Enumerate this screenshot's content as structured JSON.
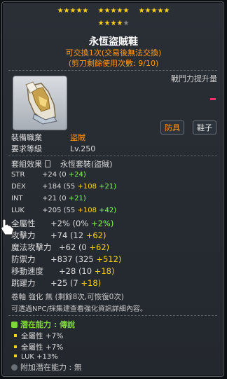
{
  "stars": {
    "filled_groups": [
      "★★★★★",
      "★★★★★",
      "★★★★★"
    ],
    "row2_filled": "★★★★",
    "row2_dim": "★"
  },
  "title": "永恆盜賊鞋",
  "tradeable_line": "可交換1次(交易後無法交換)",
  "scissors_line": "(剪刀剩餘使用次數: 9/10)",
  "combat_power_label": "戰鬥力提升量",
  "tags": {
    "job": "防具",
    "kind": "鞋子"
  },
  "equip_job_label": "裝備職業",
  "equip_job_value": "盜賊",
  "req_level_label": "要求等級",
  "req_level_value": "Lv.250",
  "set_label": "套組效果",
  "set_value": "永恆套裝(盜賊)",
  "stats": [
    {
      "name": "STR",
      "v": "+24",
      "p1": "(0",
      "p2": "+24)",
      "p3": ""
    },
    {
      "name": "DEX",
      "v": "+184",
      "p1": "(55",
      "p2": "+108",
      "p3": "+21)"
    },
    {
      "name": "INT",
      "v": "+21",
      "p1": "(0",
      "p2": "+21)",
      "p3": ""
    },
    {
      "name": "LUK",
      "v": "+205",
      "p1": "(55",
      "p2": "+108",
      "p3": "+42)"
    }
  ],
  "big_stats": [
    {
      "name": "全屬性",
      "v": "+2%",
      "p1": "(0%",
      "p2": "+2%)",
      "p3": ""
    },
    {
      "name": "攻擊力",
      "v": "+74",
      "p1": "(12",
      "p2": "+62)",
      "p3": ""
    },
    {
      "name": "魔法攻擊力",
      "v": "+62",
      "p1": "(0",
      "p2": "+62)",
      "p3": ""
    },
    {
      "name": "防禦力",
      "v": "+837",
      "p1": "(325",
      "p2": "+512)",
      "p3": ""
    },
    {
      "name": "移動速度",
      "v": "+28",
      "p1": "(10",
      "p2": "+18)",
      "p3": ""
    },
    {
      "name": "跳躍力",
      "v": "+25",
      "p1": "(7",
      "p2": "+18)",
      "p3": ""
    }
  ],
  "scroll_line": "卷軸 強化 無 (剩餘8次,可恢復0次)",
  "npc_line": "可透過NPC/採集建查看強化資訊詳細內容。",
  "potential": {
    "header": "潛在能力 : 傳說",
    "lines": [
      "全屬性 +7%",
      "全屬性 +7%",
      "LUK +13%"
    ]
  },
  "add_potential": "附加潛在能力 : 無",
  "colors": {
    "legendary": "#7fd63a",
    "orange": "#ff9a1e",
    "green": "#7cff4d",
    "yellow": "#ffd21a"
  }
}
